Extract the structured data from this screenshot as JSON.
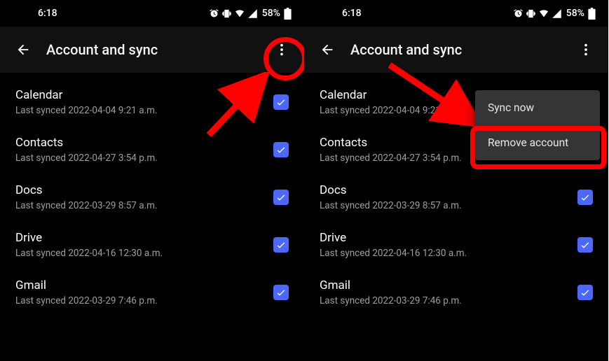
{
  "status": {
    "time": "6:18",
    "battery_pct": "58%"
  },
  "header": {
    "title": "Account and sync"
  },
  "items": [
    {
      "title": "Calendar",
      "sub": "Last synced 2022-04-04 9:21 a.m."
    },
    {
      "title": "Contacts",
      "sub": "Last synced 2022-04-27 3:54 p.m."
    },
    {
      "title": "Docs",
      "sub": "Last synced 2022-03-29 8:57 a.m."
    },
    {
      "title": "Drive",
      "sub": "Last synced 2022-04-16 12:30 a.m."
    },
    {
      "title": "Gmail",
      "sub": "Last synced 2022-03-29 7:46 p.m."
    }
  ],
  "popup": {
    "sync_now": "Sync now",
    "remove_account": "Remove account"
  }
}
